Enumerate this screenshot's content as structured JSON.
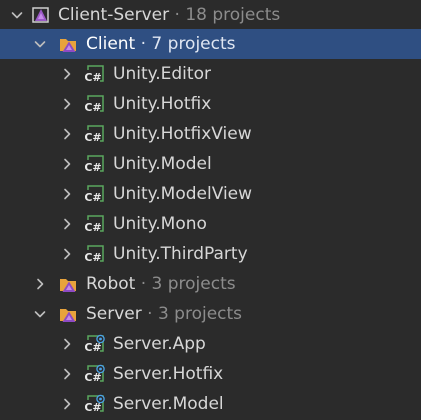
{
  "colors": {
    "background": "#2b2b2b",
    "selection": "#2f4f82",
    "text": "#d7d7d7",
    "meta_text": "#8c8c8c",
    "folder": "#e8a33c",
    "solution": "#9b59c7",
    "csharp_box": "#3f8b43"
  },
  "tree": {
    "solution": {
      "name": "Client-Server",
      "meta": " · 18 projects",
      "icon": "solution-icon",
      "expanded": true
    },
    "client": {
      "name": "Client",
      "meta": " · 7 projects",
      "icon": "solution-folder-icon",
      "expanded": true,
      "selected": true,
      "projects": [
        {
          "name": "Unity.Editor",
          "icon": "csharp-project-icon"
        },
        {
          "name": "Unity.Hotfix",
          "icon": "csharp-project-icon"
        },
        {
          "name": "Unity.HotfixView",
          "icon": "csharp-project-icon"
        },
        {
          "name": "Unity.Model",
          "icon": "csharp-project-icon"
        },
        {
          "name": "Unity.ModelView",
          "icon": "csharp-project-icon"
        },
        {
          "name": "Unity.Mono",
          "icon": "csharp-project-icon"
        },
        {
          "name": "Unity.ThirdParty",
          "icon": "csharp-project-icon"
        }
      ]
    },
    "robot": {
      "name": "Robot",
      "meta": " · 3 projects",
      "icon": "solution-folder-icon",
      "expanded": false
    },
    "server": {
      "name": "Server",
      "meta": " · 3 projects",
      "icon": "solution-folder-icon",
      "expanded": true,
      "projects": [
        {
          "name": "Server.App",
          "icon": "csharp-dotnet-project-icon"
        },
        {
          "name": "Server.Hotfix",
          "icon": "csharp-dotnet-project-icon"
        },
        {
          "name": "Server.Model",
          "icon": "csharp-dotnet-project-icon"
        }
      ]
    }
  }
}
